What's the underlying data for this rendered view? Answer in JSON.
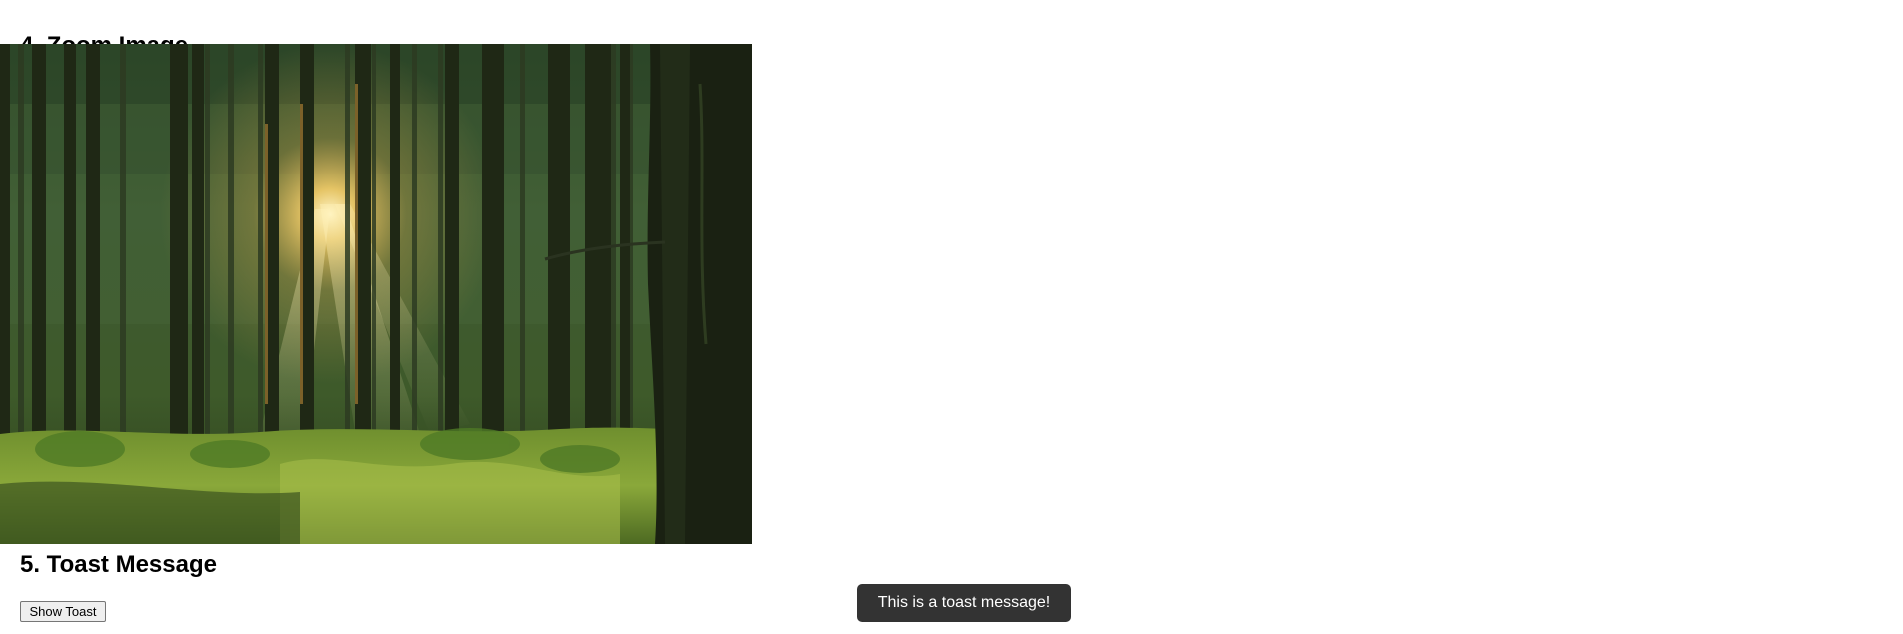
{
  "sections": {
    "zoom": {
      "heading": "4. Zoom Image"
    },
    "toast": {
      "heading": "5. Toast Message",
      "button_label": "Show Toast",
      "message": "This is a toast message!"
    }
  },
  "image": {
    "subject": "sunlit forest"
  },
  "colors": {
    "toast_background": "#333333",
    "toast_text": "#ffffff",
    "button_background": "#efefef",
    "button_border": "#767676"
  }
}
